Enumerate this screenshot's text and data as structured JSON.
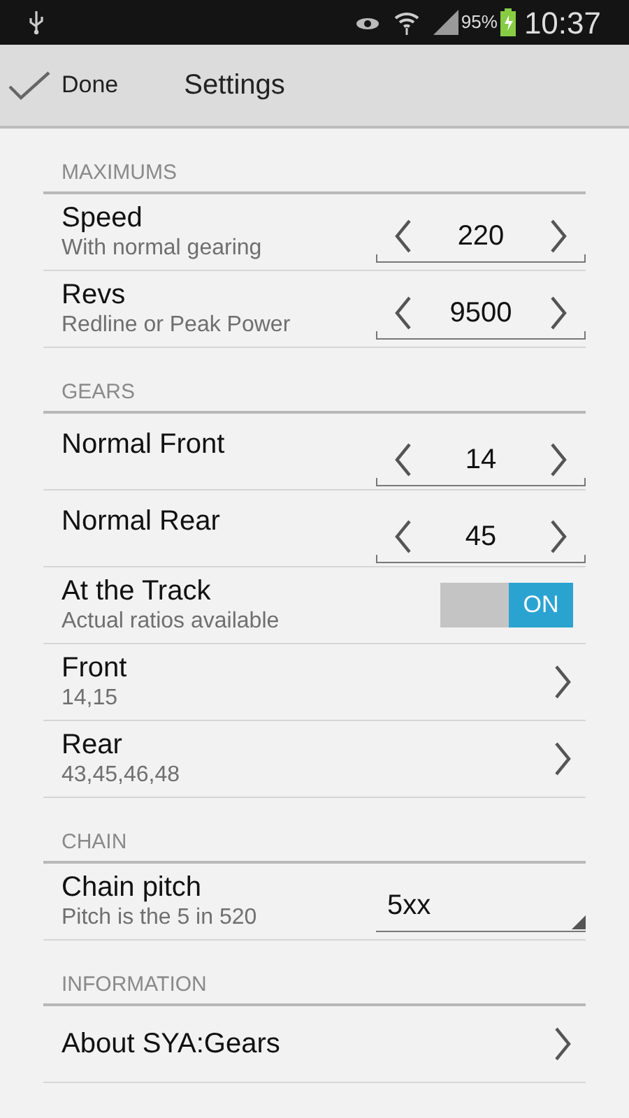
{
  "status_bar": {
    "battery": "95%",
    "time": "10:37"
  },
  "action_bar": {
    "done": "Done",
    "title": "Settings"
  },
  "sections": [
    {
      "header": "MAXIMUMS",
      "rows": [
        {
          "kind": "stepper",
          "title": "Speed",
          "subtitle": "With normal gearing",
          "value": "220"
        },
        {
          "kind": "stepper",
          "title": "Revs",
          "subtitle": "Redline or Peak Power",
          "value": "9500"
        }
      ]
    },
    {
      "header": "GEARS",
      "rows": [
        {
          "kind": "stepper",
          "title": "Normal Front",
          "value": "14"
        },
        {
          "kind": "stepper",
          "title": "Normal Rear",
          "value": "45"
        },
        {
          "kind": "switch",
          "title": "At the Track",
          "subtitle": "Actual ratios available",
          "on": true,
          "switch_label": "ON"
        },
        {
          "kind": "link",
          "title": "Front",
          "subtitle": "14,15"
        },
        {
          "kind": "link",
          "title": "Rear",
          "subtitle": "43,45,46,48"
        }
      ]
    },
    {
      "header": "CHAIN",
      "rows": [
        {
          "kind": "dropdown",
          "title": "Chain pitch",
          "subtitle": "Pitch is the 5 in 520",
          "value": "5xx"
        }
      ]
    },
    {
      "header": "INFORMATION",
      "rows": [
        {
          "kind": "link",
          "title": "About SYA:Gears"
        }
      ]
    }
  ]
}
